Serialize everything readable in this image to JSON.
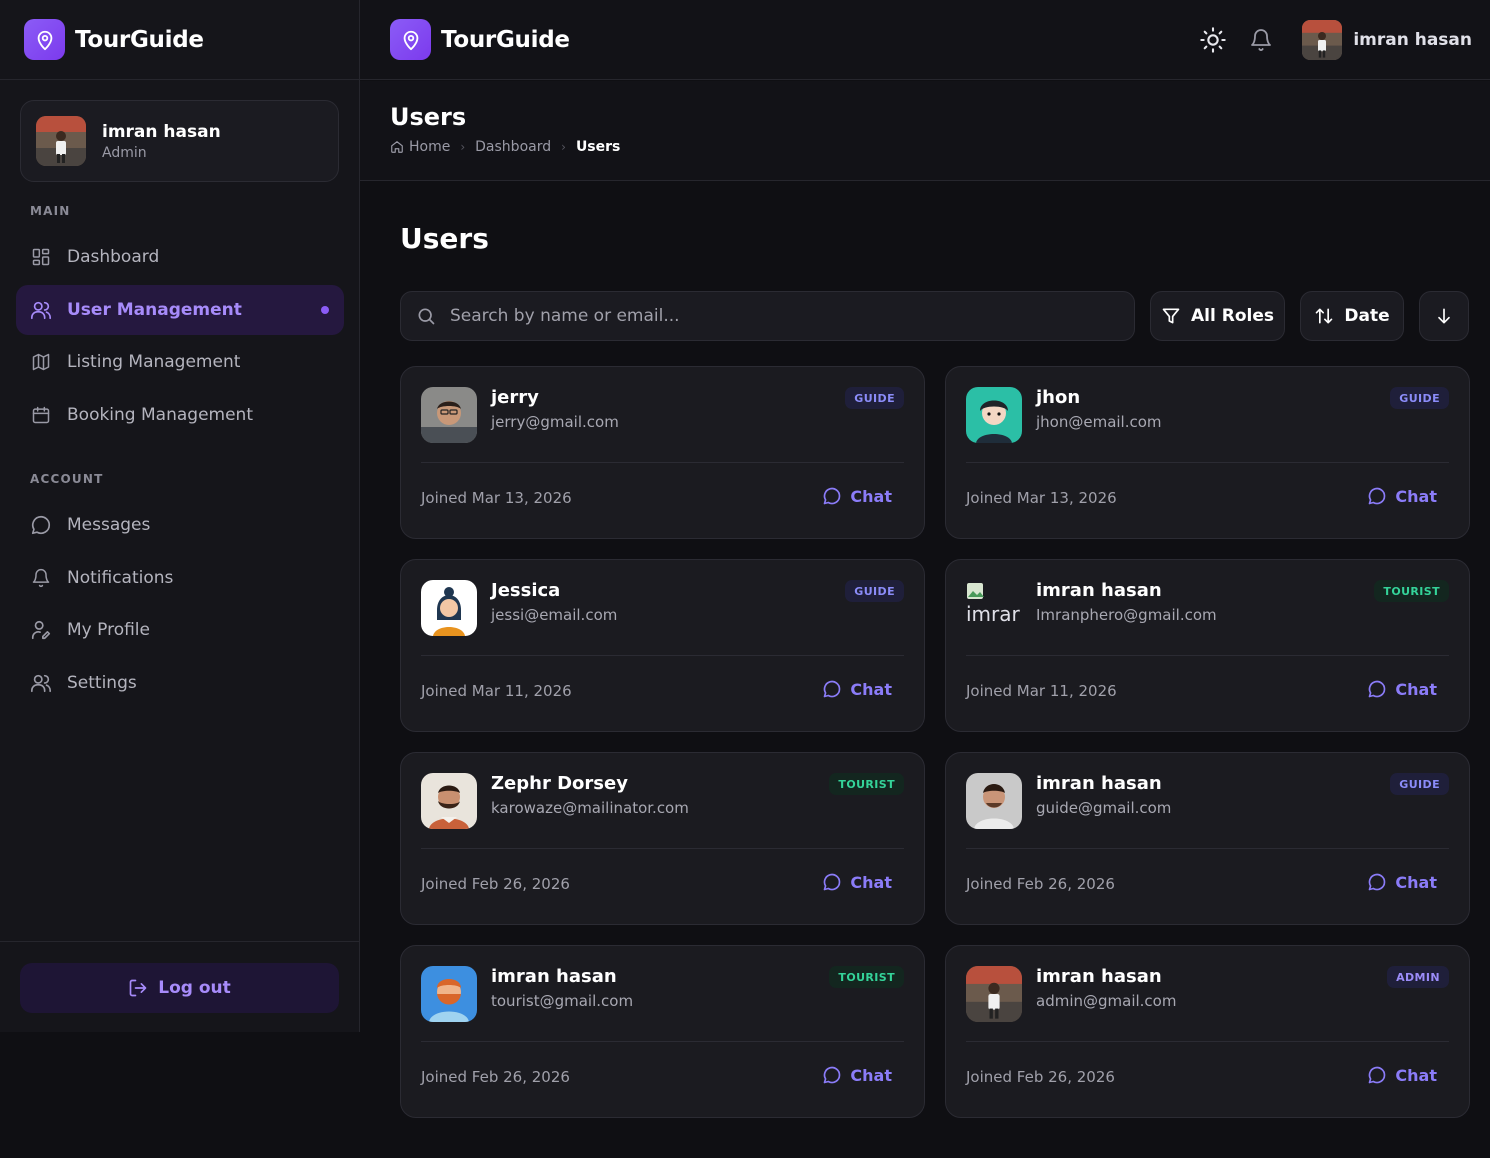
{
  "brand": {
    "name": "TourGuide"
  },
  "sidebar": {
    "profile": {
      "name": "imran hasan",
      "role": "Admin"
    },
    "sections": {
      "main": "MAIN",
      "account": "ACCOUNT"
    },
    "main_items": [
      {
        "label": "Dashboard"
      },
      {
        "label": "User Management"
      },
      {
        "label": "Listing Management"
      },
      {
        "label": "Booking Management"
      }
    ],
    "account_items": [
      {
        "label": "Messages"
      },
      {
        "label": "Notifications"
      },
      {
        "label": "My Profile"
      },
      {
        "label": "Settings"
      }
    ],
    "logout": "Log out"
  },
  "header": {
    "user_name": "imran hasan"
  },
  "pagehead": {
    "title": "Users",
    "breadcrumb": [
      "Home",
      "Dashboard",
      "Users"
    ]
  },
  "main": {
    "title": "Users",
    "search_placeholder": "Search by name or email...",
    "roles_filter": "All Roles",
    "sort_label": "Date"
  },
  "users": [
    {
      "name": "jerry",
      "email": "jerry@gmail.com",
      "role": "GUIDE",
      "joined": "Joined Mar 13, 2026",
      "chat": "Chat"
    },
    {
      "name": "jhon",
      "email": "jhon@email.com",
      "role": "GUIDE",
      "joined": "Joined Mar 13, 2026",
      "chat": "Chat"
    },
    {
      "name": "Jessica",
      "email": "jessi@email.com",
      "role": "GUIDE",
      "joined": "Joined Mar 11, 2026",
      "chat": "Chat"
    },
    {
      "name": "imran hasan",
      "email": "Imranphero@gmail.com",
      "role": "TOURIST",
      "joined": "Joined Mar 11, 2026",
      "chat": "Chat",
      "alt": "imrar"
    },
    {
      "name": "Zephr Dorsey",
      "email": "karowaze@mailinator.com",
      "role": "TOURIST",
      "joined": "Joined Feb 26, 2026",
      "chat": "Chat"
    },
    {
      "name": "imran hasan",
      "email": "guide@gmail.com",
      "role": "GUIDE",
      "joined": "Joined Feb 26, 2026",
      "chat": "Chat"
    },
    {
      "name": "imran hasan",
      "email": "tourist@gmail.com",
      "role": "TOURIST",
      "joined": "Joined Feb 26, 2026",
      "chat": "Chat"
    },
    {
      "name": "imran hasan",
      "email": "admin@gmail.com",
      "role": "ADMIN",
      "joined": "Joined Feb 26, 2026",
      "chat": "Chat"
    }
  ],
  "colors": {
    "accent": "#8b5cf6",
    "background": "#0f0f13",
    "card": "#1b1b20",
    "guide_badge": "#8b8cf8",
    "tourist_badge": "#34d399"
  }
}
